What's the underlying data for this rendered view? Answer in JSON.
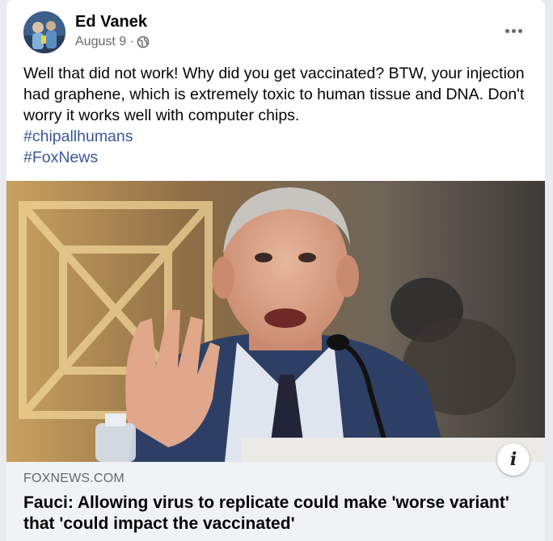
{
  "post": {
    "author": "Ed Vanek",
    "date": "August 9",
    "separator": "·",
    "audience_icon": "globe-icon",
    "more_icon": "more-options-icon",
    "text": "Well that did not work! Why did you get vaccinated? BTW, your injection had graphene, which is extremely toxic to human tissue and DNA. Don't worry it works well with computer chips.",
    "hashtags": [
      "#chipallhumans",
      "#FoxNews"
    ]
  },
  "link_preview": {
    "domain": "FOXNEWS.COM",
    "headline": "Fauci: Allowing virus to replicate could make 'worse variant' that 'could impact the vaccinated'",
    "info_icon": "info-icon",
    "info_glyph": "i"
  },
  "colors": {
    "text": "#050505",
    "secondary": "#65676b",
    "hashtag": "#385898",
    "preview_bg": "#f0f2f5"
  }
}
